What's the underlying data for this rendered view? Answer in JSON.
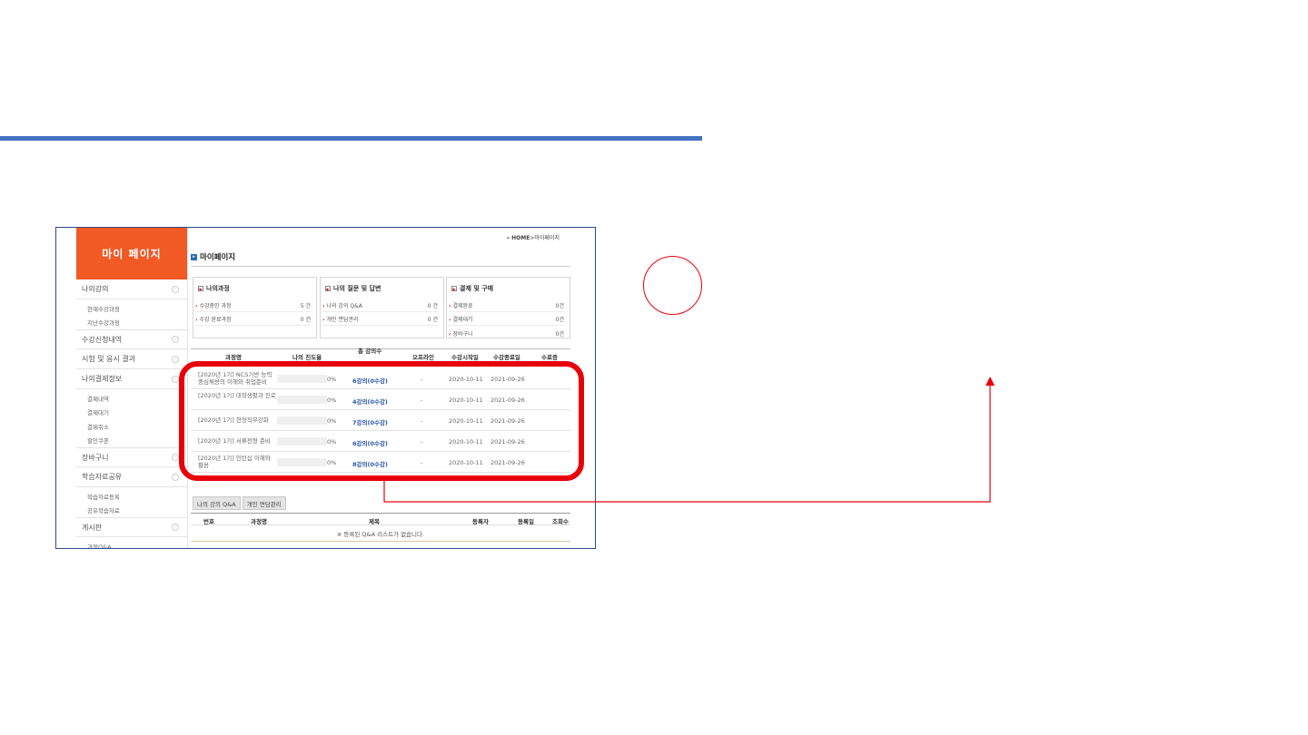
{
  "breadcrumb": {
    "home": "HOME",
    "current": "마이페이지"
  },
  "page_title": "마이페이지",
  "sidebar": {
    "title": "마이 페이지",
    "categories": [
      {
        "label": "나의강의",
        "subs": [
          "현재수강과정",
          "지난수강과정"
        ]
      },
      {
        "label": "수강신청내역",
        "subs": []
      },
      {
        "label": "시험 및 응시 결과",
        "subs": []
      },
      {
        "label": "나의결제정보",
        "subs": [
          "결제내역",
          "결제대기",
          "결제취소",
          "할인쿠폰"
        ]
      },
      {
        "label": "장바구니",
        "subs": []
      },
      {
        "label": "학습자료공유",
        "subs": [
          "학습자료등록",
          "공유학습자료"
        ]
      },
      {
        "label": "게시판",
        "subs": [
          "과정Q&A"
        ]
      }
    ]
  },
  "summary_boxes": [
    {
      "title": "나의과정",
      "rows": [
        {
          "label": "수강중인 과정",
          "value": "5 건"
        },
        {
          "label": "수강 완료과정",
          "value": "0 건"
        }
      ]
    },
    {
      "title": "나의 질문 및 답변",
      "rows": [
        {
          "label": "나의 강의 Q&A",
          "value": "0 건"
        },
        {
          "label": "개인 면담관리",
          "value": "0 건"
        }
      ]
    },
    {
      "title": "결제 및 구매",
      "rows": [
        {
          "label": "결제완료",
          "value": "0건"
        },
        {
          "label": "결제대기",
          "value": "0건"
        },
        {
          "label": "장바구니",
          "value": "0건"
        }
      ]
    }
  ],
  "course_table": {
    "headers": {
      "course": "과정명",
      "progress": "나의 진도율",
      "lectures": "총 강의수",
      "offline": "오프라인",
      "start": "수강시작일",
      "end": "수강종료일",
      "cert": "수료증"
    },
    "rows": [
      {
        "name": "[2020년 1기] NCS기반 능력중심채용의 이해와 취업준비",
        "progress": "0%",
        "lectures": "6강의(0수강)",
        "offline": "-",
        "start": "2020-10-11",
        "end": "2021-09-26"
      },
      {
        "name": "[2020년 1기] 대학생활과 진로",
        "progress": "0%",
        "lectures": "4강의(0수강)",
        "offline": "-",
        "start": "2020-10-11",
        "end": "2021-09-26"
      },
      {
        "name": "[2020년 1기] 현장직무강화",
        "progress": "0%",
        "lectures": "7강의(0수강)",
        "offline": "-",
        "start": "2020-10-11",
        "end": "2021-09-26"
      },
      {
        "name": "[2020년 1기] 서류전형 준비",
        "progress": "0%",
        "lectures": "6강의(0수강)",
        "offline": "-",
        "start": "2020-10-11",
        "end": "2021-09-26"
      },
      {
        "name": "[2020년 1기] 인턴십 이해와 활용",
        "progress": "0%",
        "lectures": "8강의(0수강)",
        "offline": "-",
        "start": "2020-10-11",
        "end": "2021-09-26"
      }
    ]
  },
  "tabs": [
    "나의 강의 Q&A",
    "개인 면담관리"
  ],
  "qa_table": {
    "headers": {
      "no": "번호",
      "course": "과정명",
      "title": "제목",
      "author": "등록자",
      "date": "등록일",
      "views": "조회수"
    },
    "empty_message": "※ 등록된 Q&A 리스트가 없습니다."
  },
  "colors": {
    "accent_blue": "#4472c4",
    "sidebar_header": "#f15a24",
    "highlight_red": "#e8000b"
  }
}
